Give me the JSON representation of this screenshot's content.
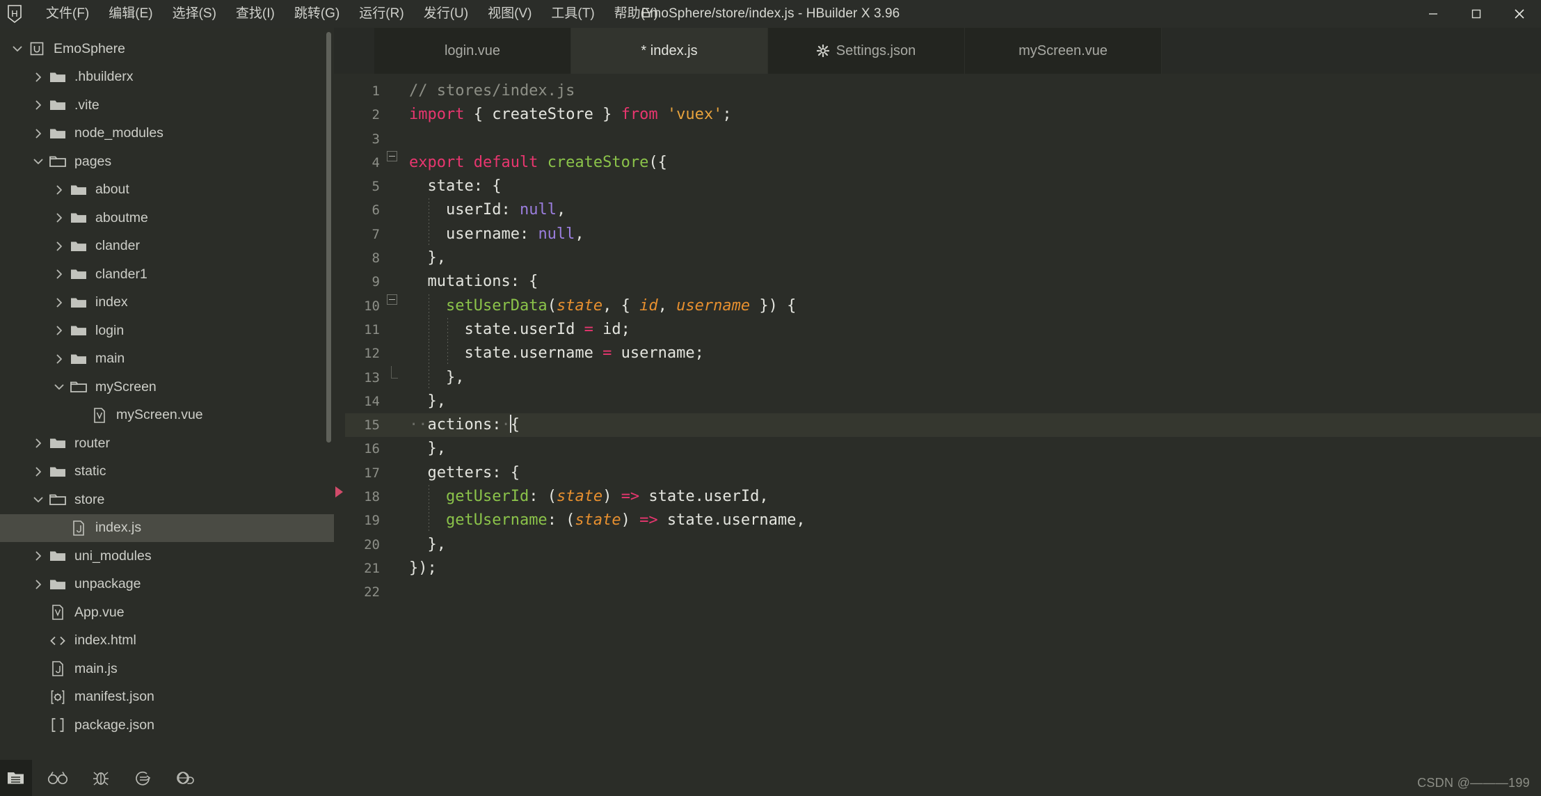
{
  "window": {
    "title": "EmoSphere/store/index.js - HBuilder X 3.96",
    "logo_label": "H",
    "minimize_label": "─",
    "maximize_label": "☐",
    "close_label": "✕"
  },
  "menubar": {
    "items": [
      {
        "label": "文件(F)",
        "name": "menu-file"
      },
      {
        "label": "编辑(E)",
        "name": "menu-edit"
      },
      {
        "label": "选择(S)",
        "name": "menu-select"
      },
      {
        "label": "查找(I)",
        "name": "menu-find"
      },
      {
        "label": "跳转(G)",
        "name": "menu-goto"
      },
      {
        "label": "运行(R)",
        "name": "menu-run"
      },
      {
        "label": "发行(U)",
        "name": "menu-publish"
      },
      {
        "label": "视图(V)",
        "name": "menu-view"
      },
      {
        "label": "工具(T)",
        "name": "menu-tools"
      },
      {
        "label": "帮助(Y)",
        "name": "menu-help"
      }
    ]
  },
  "sidebar": {
    "tree": [
      {
        "label": "EmoSphere",
        "depth": 0,
        "twisty": "down",
        "icon": "project-icon",
        "selected": false
      },
      {
        "label": ".hbuilderx",
        "depth": 1,
        "twisty": "right",
        "icon": "folder-icon",
        "selected": false
      },
      {
        "label": ".vite",
        "depth": 1,
        "twisty": "right",
        "icon": "folder-icon",
        "selected": false
      },
      {
        "label": "node_modules",
        "depth": 1,
        "twisty": "right",
        "icon": "folder-icon",
        "selected": false
      },
      {
        "label": "pages",
        "depth": 1,
        "twisty": "down",
        "icon": "folder-open-icon",
        "selected": false
      },
      {
        "label": "about",
        "depth": 2,
        "twisty": "right",
        "icon": "folder-icon",
        "selected": false
      },
      {
        "label": "aboutme",
        "depth": 2,
        "twisty": "right",
        "icon": "folder-icon",
        "selected": false
      },
      {
        "label": "clander",
        "depth": 2,
        "twisty": "right",
        "icon": "folder-icon",
        "selected": false
      },
      {
        "label": "clander1",
        "depth": 2,
        "twisty": "right",
        "icon": "folder-icon",
        "selected": false
      },
      {
        "label": "index",
        "depth": 2,
        "twisty": "right",
        "icon": "folder-icon",
        "selected": false
      },
      {
        "label": "login",
        "depth": 2,
        "twisty": "right",
        "icon": "folder-icon",
        "selected": false
      },
      {
        "label": "main",
        "depth": 2,
        "twisty": "right",
        "icon": "folder-icon",
        "selected": false
      },
      {
        "label": "myScreen",
        "depth": 2,
        "twisty": "down",
        "icon": "folder-open-icon",
        "selected": false
      },
      {
        "label": "myScreen.vue",
        "depth": 3,
        "twisty": "none",
        "icon": "vue-file-icon",
        "selected": false
      },
      {
        "label": "router",
        "depth": 1,
        "twisty": "right",
        "icon": "folder-icon",
        "selected": false
      },
      {
        "label": "static",
        "depth": 1,
        "twisty": "right",
        "icon": "folder-icon",
        "selected": false
      },
      {
        "label": "store",
        "depth": 1,
        "twisty": "down",
        "icon": "folder-open-icon",
        "selected": false
      },
      {
        "label": "index.js",
        "depth": 2,
        "twisty": "none",
        "icon": "js-file-icon",
        "selected": true
      },
      {
        "label": "uni_modules",
        "depth": 1,
        "twisty": "right",
        "icon": "folder-icon",
        "selected": false
      },
      {
        "label": "unpackage",
        "depth": 1,
        "twisty": "right",
        "icon": "folder-icon",
        "selected": false
      },
      {
        "label": "App.vue",
        "depth": 1,
        "twisty": "none",
        "icon": "vue-file-icon",
        "selected": false
      },
      {
        "label": "index.html",
        "depth": 1,
        "twisty": "none",
        "icon": "html-file-icon",
        "selected": false
      },
      {
        "label": "main.js",
        "depth": 1,
        "twisty": "none",
        "icon": "js-file-icon",
        "selected": false
      },
      {
        "label": "manifest.json",
        "depth": 1,
        "twisty": "none",
        "icon": "manifest-file-icon",
        "selected": false
      },
      {
        "label": "package.json",
        "depth": 1,
        "twisty": "none",
        "icon": "json-file-icon",
        "selected": false
      }
    ],
    "bottom_bar": [
      {
        "name": "explorer-panel-icon",
        "active": true
      },
      {
        "name": "search-panel-icon",
        "active": false
      },
      {
        "name": "debug-panel-icon",
        "active": false
      },
      {
        "name": "terminal-panel-icon",
        "active": false
      },
      {
        "name": "network-panel-icon",
        "active": false
      }
    ]
  },
  "editor": {
    "tabs": [
      {
        "label": "login.vue",
        "active": false,
        "modified": false,
        "icon": "none"
      },
      {
        "label": "* index.js",
        "active": true,
        "modified": true,
        "icon": "none"
      },
      {
        "label": "Settings.json",
        "active": false,
        "modified": false,
        "icon": "gear-icon"
      },
      {
        "label": "myScreen.vue",
        "active": false,
        "modified": false,
        "icon": "none"
      }
    ],
    "lines": [
      {
        "n": "1",
        "fold": "none",
        "guides": 0,
        "active": false,
        "tokens": [
          {
            "t": "com",
            "v": "// stores/index.js"
          }
        ]
      },
      {
        "n": "2",
        "fold": "none",
        "guides": 0,
        "active": false,
        "tokens": [
          {
            "t": "kw",
            "v": "import"
          },
          {
            "t": "pun",
            "v": " { "
          },
          {
            "t": "prop",
            "v": "createStore"
          },
          {
            "t": "pun",
            "v": " } "
          },
          {
            "t": "kw",
            "v": "from"
          },
          {
            "t": "pun",
            "v": " "
          },
          {
            "t": "str",
            "v": "'vuex'"
          },
          {
            "t": "pun",
            "v": ";"
          }
        ]
      },
      {
        "n": "3",
        "fold": "none",
        "guides": 0,
        "active": false,
        "tokens": []
      },
      {
        "n": "4",
        "fold": "minus",
        "guides": 0,
        "active": false,
        "tokens": [
          {
            "t": "kw",
            "v": "export default"
          },
          {
            "t": "pun",
            "v": " "
          },
          {
            "t": "fn",
            "v": "createStore"
          },
          {
            "t": "pun",
            "v": "({"
          }
        ]
      },
      {
        "n": "5",
        "fold": "bar",
        "guides": 0,
        "active": false,
        "tokens": [
          {
            "t": "prop",
            "v": "  state: {"
          }
        ]
      },
      {
        "n": "6",
        "fold": "bar",
        "guides": 1,
        "active": false,
        "tokens": [
          {
            "t": "prop",
            "v": "    userId: "
          },
          {
            "t": "num",
            "v": "null"
          },
          {
            "t": "pun",
            "v": ","
          }
        ]
      },
      {
        "n": "7",
        "fold": "bar",
        "guides": 1,
        "active": false,
        "tokens": [
          {
            "t": "prop",
            "v": "    username: "
          },
          {
            "t": "num",
            "v": "null"
          },
          {
            "t": "pun",
            "v": ","
          }
        ]
      },
      {
        "n": "8",
        "fold": "bar",
        "guides": 0,
        "active": false,
        "tokens": [
          {
            "t": "pun",
            "v": "  },"
          }
        ]
      },
      {
        "n": "9",
        "fold": "bar",
        "guides": 0,
        "active": false,
        "tokens": [
          {
            "t": "prop",
            "v": "  mutations: {"
          }
        ]
      },
      {
        "n": "10",
        "fold": "minus",
        "guides": 1,
        "active": false,
        "tokens": [
          {
            "t": "pun",
            "v": "    "
          },
          {
            "t": "fn",
            "v": "setUserData"
          },
          {
            "t": "pun",
            "v": "("
          },
          {
            "t": "par",
            "v": "state"
          },
          {
            "t": "pun",
            "v": ", { "
          },
          {
            "t": "par",
            "v": "id"
          },
          {
            "t": "pun",
            "v": ", "
          },
          {
            "t": "par",
            "v": "username"
          },
          {
            "t": "pun",
            "v": " }) {"
          }
        ]
      },
      {
        "n": "11",
        "fold": "bar",
        "guides": 2,
        "active": false,
        "tokens": [
          {
            "t": "prop",
            "v": "      state.userId "
          },
          {
            "t": "op",
            "v": "="
          },
          {
            "t": "prop",
            "v": " id"
          },
          {
            "t": "pun",
            "v": ";"
          }
        ]
      },
      {
        "n": "12",
        "fold": "bar",
        "guides": 2,
        "active": false,
        "tokens": [
          {
            "t": "prop",
            "v": "      state.username "
          },
          {
            "t": "op",
            "v": "="
          },
          {
            "t": "prop",
            "v": " username"
          },
          {
            "t": "pun",
            "v": ";"
          }
        ]
      },
      {
        "n": "13",
        "fold": "end",
        "guides": 1,
        "active": false,
        "tokens": [
          {
            "t": "pun",
            "v": "    },"
          }
        ]
      },
      {
        "n": "14",
        "fold": "bar",
        "guides": 0,
        "active": false,
        "tokens": [
          {
            "t": "pun",
            "v": "  },"
          }
        ]
      },
      {
        "n": "15",
        "fold": "bar",
        "guides": 0,
        "active": true,
        "tokens": [
          {
            "t": "ws",
            "v": "··"
          },
          {
            "t": "prop",
            "v": "actions:"
          },
          {
            "t": "ws",
            "v": "·"
          },
          {
            "t": "pun",
            "v": "{"
          }
        ],
        "caret_after": 4
      },
      {
        "n": "16",
        "fold": "bar",
        "guides": 0,
        "active": false,
        "tokens": [
          {
            "t": "pun",
            "v": "  },"
          }
        ]
      },
      {
        "n": "17",
        "fold": "bar",
        "guides": 0,
        "active": false,
        "tokens": [
          {
            "t": "prop",
            "v": "  getters: {"
          }
        ]
      },
      {
        "n": "18",
        "fold": "bar",
        "guides": 1,
        "active": false,
        "tokens": [
          {
            "t": "pun",
            "v": "    "
          },
          {
            "t": "fn",
            "v": "getUserId"
          },
          {
            "t": "pun",
            "v": ": ("
          },
          {
            "t": "par",
            "v": "state"
          },
          {
            "t": "pun",
            "v": ") "
          },
          {
            "t": "op",
            "v": "=>"
          },
          {
            "t": "prop",
            "v": " state.userId"
          },
          {
            "t": "pun",
            "v": ","
          }
        ]
      },
      {
        "n": "19",
        "fold": "bar",
        "guides": 1,
        "active": false,
        "tokens": [
          {
            "t": "pun",
            "v": "    "
          },
          {
            "t": "fn",
            "v": "getUsername"
          },
          {
            "t": "pun",
            "v": ": ("
          },
          {
            "t": "par",
            "v": "state"
          },
          {
            "t": "pun",
            "v": ") "
          },
          {
            "t": "op",
            "v": "=>"
          },
          {
            "t": "prop",
            "v": " state.username"
          },
          {
            "t": "pun",
            "v": ","
          }
        ]
      },
      {
        "n": "20",
        "fold": "bar",
        "guides": 0,
        "active": false,
        "tokens": [
          {
            "t": "pun",
            "v": "  },"
          }
        ]
      },
      {
        "n": "21",
        "fold": "none",
        "guides": 0,
        "active": false,
        "tokens": [
          {
            "t": "pun",
            "v": "});"
          }
        ]
      },
      {
        "n": "22",
        "fold": "none",
        "guides": 0,
        "active": false,
        "tokens": []
      }
    ]
  },
  "watermark": {
    "text": "CSDN @———199"
  },
  "colors": {
    "bg": "#282a26",
    "sidebar_bg": "#2b2d28",
    "editor_bg": "#2b2d28",
    "tab_active_bg": "#32342e",
    "selection_bg": "#4a4b44",
    "active_line_bg": "#35372f",
    "keyword": "#e8366f",
    "function": "#8bc34a",
    "string": "#e8a33d",
    "number": "#9b7ede",
    "param": "#e8902f",
    "comment": "#8d8f86",
    "text": "#e4e5df"
  }
}
